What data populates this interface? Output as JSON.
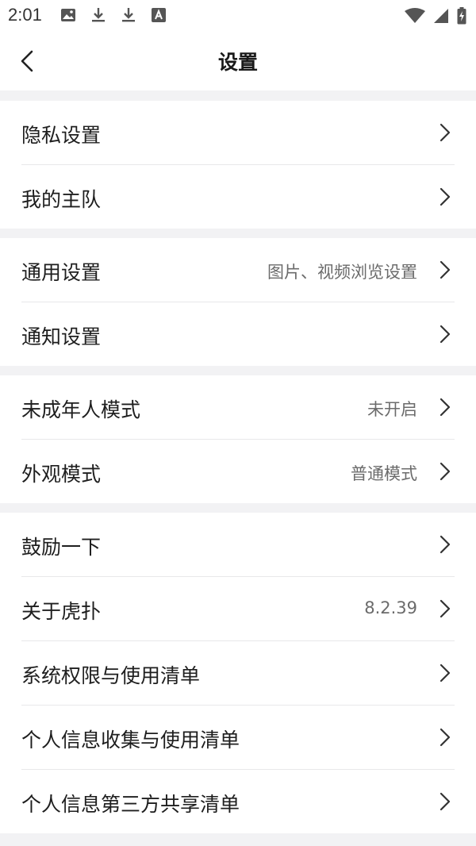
{
  "status_bar": {
    "time": "2:01",
    "left_icons": [
      "image-icon",
      "download-icon",
      "download-icon",
      "font-icon"
    ],
    "right_icons": [
      "wifi-icon",
      "signal-icon",
      "battery-icon"
    ]
  },
  "header": {
    "title": "设置",
    "back_icon": "back-arrow-icon"
  },
  "groups": [
    {
      "items": [
        {
          "label": "隐私设置",
          "value": ""
        },
        {
          "label": "我的主队",
          "value": ""
        }
      ]
    },
    {
      "items": [
        {
          "label": "通用设置",
          "value": "图片、视频浏览设置"
        },
        {
          "label": "通知设置",
          "value": ""
        }
      ]
    },
    {
      "items": [
        {
          "label": "未成年人模式",
          "value": "未开启"
        },
        {
          "label": "外观模式",
          "value": "普通模式"
        }
      ]
    },
    {
      "items": [
        {
          "label": "鼓励一下",
          "value": ""
        },
        {
          "label": "关于虎扑",
          "value": "8.2.39"
        },
        {
          "label": "系统权限与使用清单",
          "value": ""
        },
        {
          "label": "个人信息收集与使用清单",
          "value": ""
        },
        {
          "label": "个人信息第三方共享清单",
          "value": ""
        }
      ]
    }
  ],
  "colors": {
    "background": "#f2f2f4",
    "surface": "#ffffff",
    "text_primary": "#1e1e1e",
    "text_secondary": "#6b6b6b",
    "divider": "#e8e8ea"
  }
}
